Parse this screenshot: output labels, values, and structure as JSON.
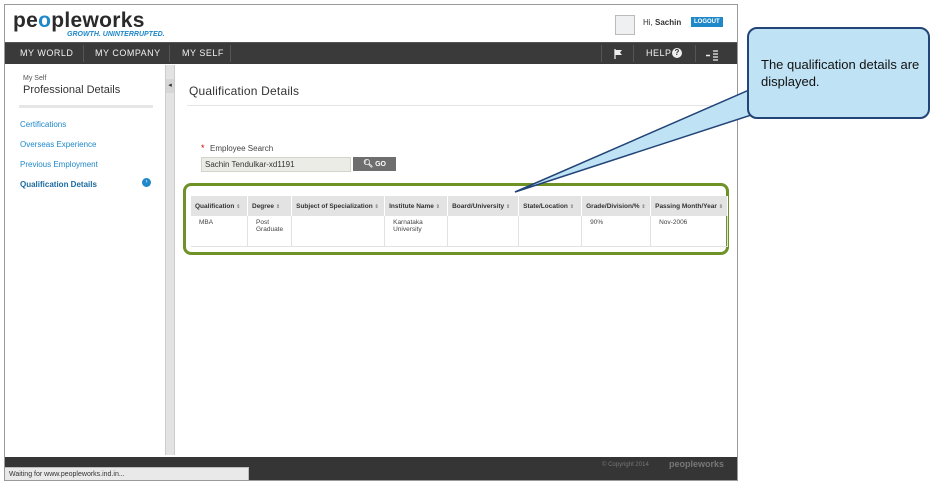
{
  "header": {
    "logo_left": "pe",
    "logo_o": "o",
    "logo_right": "pleworks",
    "tagline": "GROWTH. UNINTERRUPTED.",
    "greeting": "Hi,",
    "user_name": "Sachin",
    "logout_label": "LOGOUT"
  },
  "nav": {
    "items": [
      "MY WORLD",
      "MY COMPANY",
      "MY SELF"
    ],
    "help_label": "HELP"
  },
  "sidebar": {
    "section_small": "My Self",
    "section_title": "Professional Details",
    "links": [
      "Certifications",
      "Overseas Experience",
      "Previous Employment",
      "Qualification Details"
    ]
  },
  "main": {
    "title": "Qualification Details",
    "search_label": "Employee Search",
    "search_required": "*",
    "search_value": "Sachin Tendulkar-xd1191",
    "go_label": "GO"
  },
  "table": {
    "headers": [
      "Qualification",
      "Degree",
      "Subject of Specialization",
      "Institute Name",
      "Board/University",
      "State/Location",
      "Grade/Division/%",
      "Passing Month/Year"
    ],
    "rows": [
      [
        "MBA",
        "Post Graduate",
        "",
        "Karnataka University",
        "",
        "",
        "90%",
        "Nov-2006"
      ]
    ]
  },
  "footer": {
    "copyright": "© Copyright 2014",
    "logo": "peopleworks"
  },
  "status_bar": "Waiting for www.peopleworks.ind.in...",
  "callout": {
    "text": "The qualification details are displayed."
  },
  "colors": {
    "brand_blue": "#1e88c9",
    "nav_dark": "#3a3a3a",
    "highlight_green": "#6e9226",
    "callout_fill": "#bfe3f5",
    "callout_border": "#224477"
  }
}
